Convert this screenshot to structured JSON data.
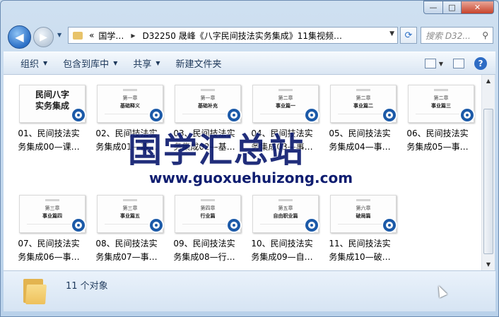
{
  "window": {
    "minimize_glyph": "—",
    "maximize_glyph": "□",
    "close_glyph": "✕"
  },
  "address": {
    "prefix": "«",
    "crumb1": "国学…",
    "crumb2": "D32250 晟峰《八字民间技法实务集成》11集视频…",
    "search_placeholder": "搜索 D32..."
  },
  "toolbar": {
    "organize": "组织",
    "include_library": "包含到库中",
    "share": "共享",
    "new_folder": "新建文件夹",
    "help": "?"
  },
  "files": [
    {
      "label": "01、民间技法实务集成00—课…",
      "thumb_t1": "民间八字",
      "thumb_t2": "实务集成",
      "cover": true
    },
    {
      "label": "02、民间技法实务集成01—基…",
      "thumb_t1": "第一章",
      "thumb_t2": "基础释义",
      "cover": false
    },
    {
      "label": "03、民间技法实务集成02—基…",
      "thumb_t1": "第一章",
      "thumb_t2": "基础补充",
      "cover": false
    },
    {
      "label": "04、民间技法实务集成03—事…",
      "thumb_t1": "第二章",
      "thumb_t2": "事业篇一",
      "cover": false
    },
    {
      "label": "05、民间技法实务集成04—事…",
      "thumb_t1": "第二章",
      "thumb_t2": "事业篇二",
      "cover": false
    },
    {
      "label": "06、民间技法实务集成05—事…",
      "thumb_t1": "第二章",
      "thumb_t2": "事业篇三",
      "cover": false
    },
    {
      "label": "07、民间技法实务集成06—事…",
      "thumb_t1": "第三章",
      "thumb_t2": "事业篇四",
      "cover": false
    },
    {
      "label": "08、民间技法实务集成07—事…",
      "thumb_t1": "第三章",
      "thumb_t2": "事业篇五",
      "cover": false
    },
    {
      "label": "09、民间技法实务集成08—行…",
      "thumb_t1": "第四章",
      "thumb_t2": "行业篇",
      "cover": false
    },
    {
      "label": "10、民间技法实务集成09—自…",
      "thumb_t1": "第五章",
      "thumb_t2": "自由职业篇",
      "cover": false
    },
    {
      "label": "11、民间技法实务集成10—破…",
      "thumb_t1": "第六章",
      "thumb_t2": "破局篇",
      "cover": false
    }
  ],
  "details": {
    "count_text": "11 个对象"
  },
  "watermark": {
    "title": "国学汇总站",
    "url": "www.guoxuehuizong.com"
  }
}
